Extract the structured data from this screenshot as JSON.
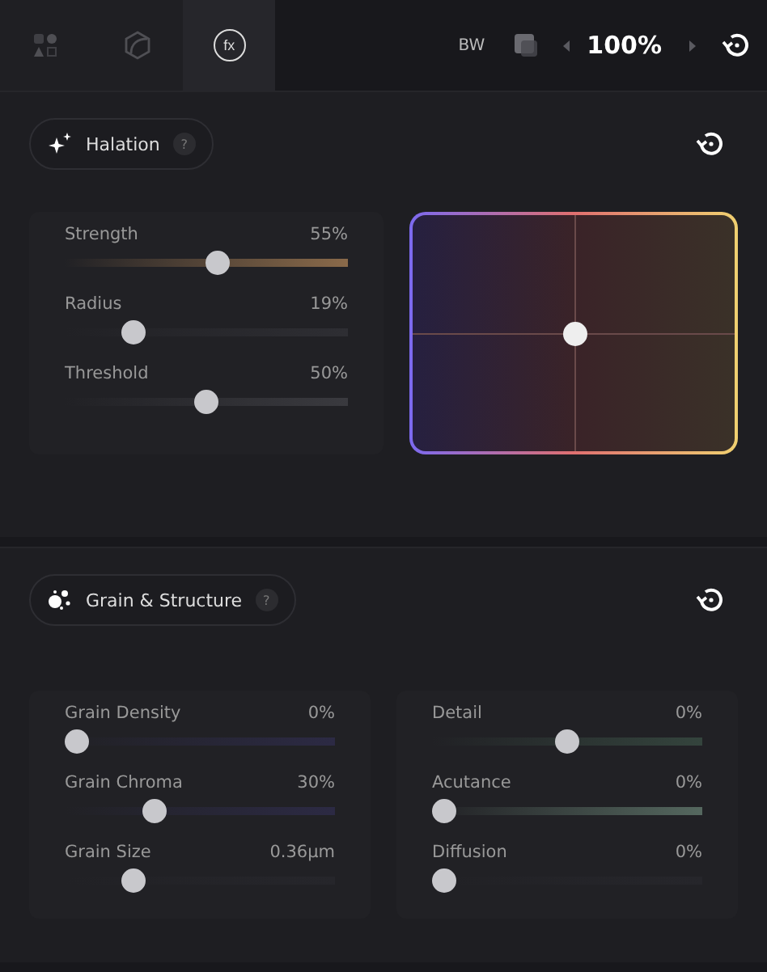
{
  "tabs": [
    {
      "kind": "shapes",
      "selected": false
    },
    {
      "kind": "cube",
      "selected": false
    },
    {
      "kind": "fx",
      "label": "fx",
      "selected": true
    }
  ],
  "toolbar": {
    "mode": "BW",
    "zoom": "100%"
  },
  "sections": [
    {
      "kind": "halation",
      "title": "Halation",
      "help": "?",
      "columns": [
        [
          {
            "label": "Strength",
            "reading": "55%",
            "level": 0.55,
            "color": "#8a6a4a"
          },
          {
            "label": "Radius",
            "reading": "19%",
            "level": 0.22,
            "color": "#2e2e33"
          },
          {
            "label": "Threshold",
            "reading": "50%",
            "level": 0.5,
            "color": "#3a3a3f"
          }
        ]
      ]
    },
    {
      "kind": "grain",
      "title": "Grain & Structure",
      "help": "?",
      "columns": [
        [
          {
            "label": "Grain Density",
            "reading": "0%",
            "level": 0,
            "color": "#2c2a44"
          },
          {
            "label": "Grain Chroma",
            "reading": "30%",
            "level": 0.32,
            "color": "#2c2a44"
          },
          {
            "label": "Grain Size",
            "reading": "0.36µm",
            "level": 0.23,
            "color": "#26262b"
          }
        ],
        [
          {
            "label": "Detail",
            "reading": "0%",
            "level": 0.5,
            "color": "#34443d"
          },
          {
            "label": "Acutance",
            "reading": "0%",
            "level": 0,
            "color": "#55685f"
          },
          {
            "label": "Diffusion",
            "reading": "0%",
            "level": 0,
            "color": "#26262b"
          }
        ]
      ]
    }
  ]
}
